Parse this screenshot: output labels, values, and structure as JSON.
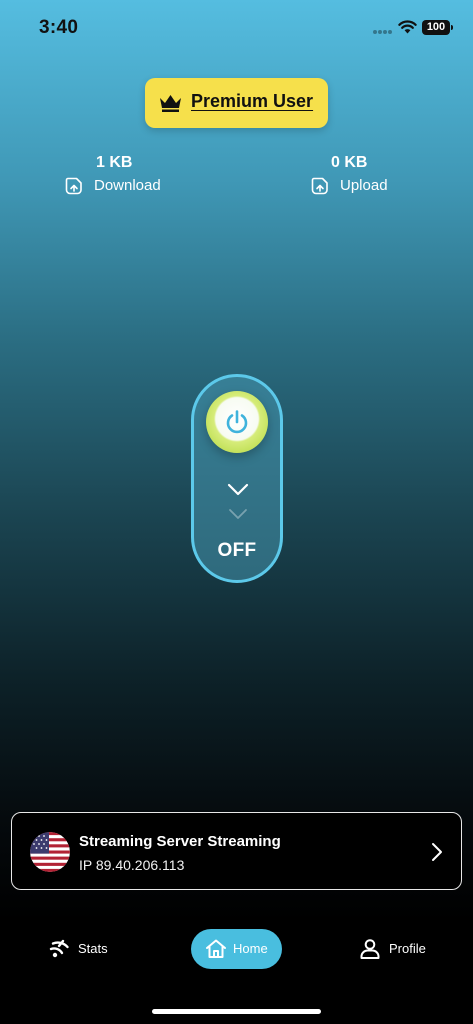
{
  "status_bar": {
    "time": "3:40",
    "battery": "100",
    "icons": [
      "signal-dots-icon",
      "wifi-icon",
      "battery-icon"
    ]
  },
  "premium": {
    "label": "Premium User",
    "icon": "crown-icon",
    "color": "#f6e04b"
  },
  "stats": {
    "download": {
      "value": "1 KB",
      "label": "Download",
      "icon": "download-icon"
    },
    "upload": {
      "value": "0 KB",
      "label": "Upload",
      "icon": "upload-icon"
    }
  },
  "toggle": {
    "state": "OFF",
    "icon": "power-icon",
    "accent": "#5cc9ea",
    "button_color": "#c6e35f"
  },
  "server": {
    "name": "Streaming Server Streaming",
    "ip": "IP 89.40.206.113",
    "flag": "us-flag-icon"
  },
  "nav": {
    "items": [
      {
        "label": "Stats",
        "icon": "stats-icon",
        "active": false
      },
      {
        "label": "Home",
        "icon": "home-icon",
        "active": true
      },
      {
        "label": "Profile",
        "icon": "profile-icon",
        "active": false
      }
    ],
    "active_color": "#49bedf"
  }
}
